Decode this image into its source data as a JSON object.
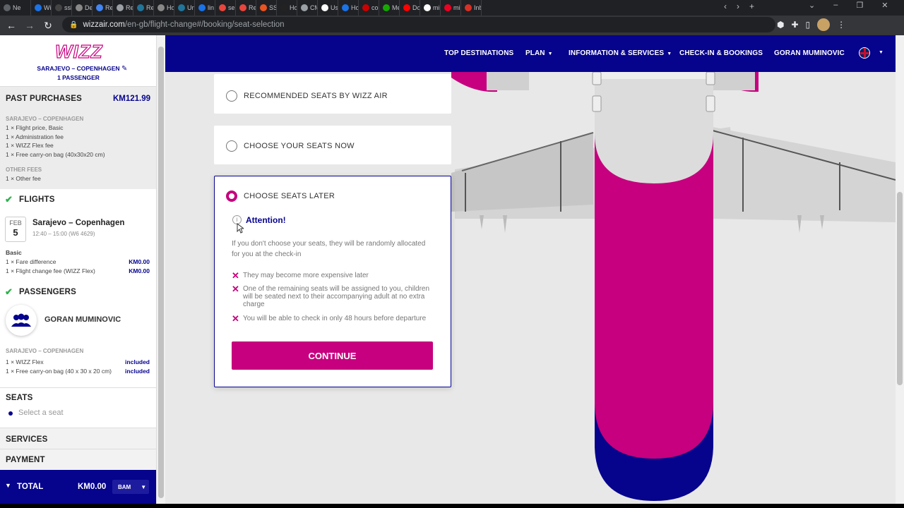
{
  "browser": {
    "tabs": [
      "Ne",
      "Wi",
      "ssl",
      "De",
      "Re",
      "Re",
      "Re",
      "Ho",
      "Un",
      "lin",
      "ser",
      "Re",
      "SSI",
      "Ho",
      "CM",
      "Us",
      "Ho",
      "cor",
      "Me",
      "Do",
      "mi",
      "mi",
      "Inb"
    ],
    "url_host": "wizzair.com",
    "url_path": "/en-gb/flight-change#/booking/seat-selection"
  },
  "sidebar": {
    "logo": "WIZZ",
    "route_title": "SARAJEVO – COPENHAGEN",
    "passenger_count": "1 PASSENGER",
    "past_purchases": {
      "title": "PAST PURCHASES",
      "total": "KM121.99",
      "route": "SARAJEVO – COPENHAGEN",
      "items": [
        "1 × Flight price, Basic",
        "1 × Administration fee",
        "1 × WIZZ Flex fee",
        "1 × Free carry-on bag (40x30x20 cm)"
      ],
      "other_fees_title": "OTHER FEES",
      "other_fees": [
        "1 × Other fee"
      ]
    },
    "flights": {
      "title": "FLIGHTS",
      "month": "FEB",
      "day": "5",
      "route": "Sarajevo – Copenhagen",
      "times": "12:40 – 15:00 (W6 4629)",
      "fare": "Basic",
      "items": [
        {
          "label": "1 × Fare difference",
          "price": "KM0.00"
        },
        {
          "label": "1 × Flight change fee (WIZZ Flex)",
          "price": "KM0.00"
        }
      ]
    },
    "passengers": {
      "title": "PASSENGERS",
      "name": "GORAN MUMINOVIC",
      "route": "SARAJEVO – COPENHAGEN",
      "items": [
        {
          "label": "1 × WIZZ Flex",
          "price": "included"
        },
        {
          "label": "1 × Free carry-on bag (40 x 30 x 20 cm)",
          "price": "included"
        }
      ]
    },
    "seats": {
      "title": "SEATS",
      "select": "Select a seat"
    },
    "services_title": "SERVICES",
    "payment_title": "PAYMENT",
    "total": {
      "label": "TOTAL",
      "amount": "KM0.00",
      "currency": "BAM"
    }
  },
  "topnav": {
    "items": [
      "TOP DESTINATIONS",
      "PLAN",
      "INFORMATION & SERVICES",
      "CHECK-IN & BOOKINGS",
      "GORAN MUMINOVIC"
    ]
  },
  "seat_options": {
    "recommended": "RECOMMENDED SEATS BY WIZZ AIR",
    "choose_now": "CHOOSE YOUR SEATS NOW",
    "choose_later": "CHOOSE SEATS LATER",
    "attention": "Attention!",
    "description": "If you don't choose your seats, they will be randomly allocated for you at the check-in",
    "warnings": [
      "They may become more expensive later",
      "One of the remaining seats will be assigned to you, children will be seated next to their accompanying adult at no extra charge",
      "You will be able to check in only 48 hours before departure"
    ],
    "continue": "CONTINUE"
  },
  "colors": {
    "brand_blue": "#06038d",
    "brand_magenta": "#c6007e",
    "success_green": "#2db24b"
  }
}
